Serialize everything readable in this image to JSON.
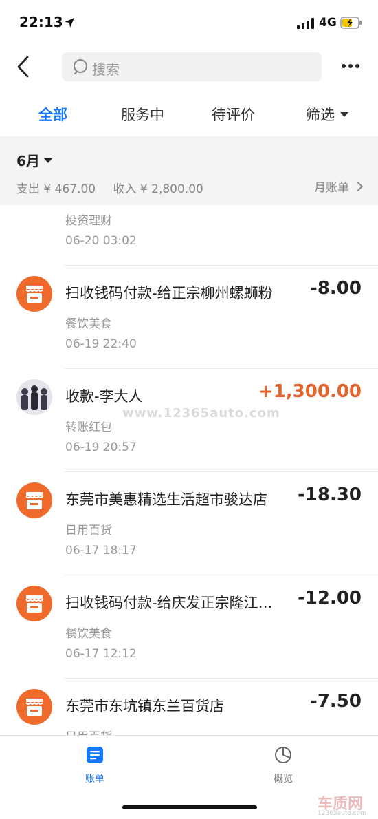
{
  "status_bar": {
    "time": "22:13",
    "network": "4G"
  },
  "search": {
    "placeholder": "搜索"
  },
  "tabs": [
    {
      "label": "全部",
      "active": true
    },
    {
      "label": "服务中",
      "active": false
    },
    {
      "label": "待评价",
      "active": false
    },
    {
      "label": "筛选",
      "active": false
    }
  ],
  "month": {
    "label": "6月",
    "expense": "支出 ¥ 467.00",
    "income": "收入 ¥ 2,800.00",
    "bill_link": "月账单"
  },
  "transactions": [
    {
      "title": "",
      "category": "投资理财",
      "date": "06-20  03:02",
      "amount": "",
      "type": "partial"
    },
    {
      "title": "扫收钱码付款-给正宗柳州螺蛳粉",
      "category": "餐饮美食",
      "date": "06-19  22:40",
      "amount": "-8.00",
      "type": "expense"
    },
    {
      "title": "收款-李大人",
      "category": "转账红包",
      "date": "06-19  20:57",
      "amount": "+1,300.00",
      "type": "income"
    },
    {
      "title": "东莞市美惠精选生活超市骏达店",
      "category": "日用百货",
      "date": "06-17  18:17",
      "amount": "-18.30",
      "type": "expense"
    },
    {
      "title": "扫收钱码付款-给庆发正宗隆江…",
      "category": "餐饮美食",
      "date": "06-17  12:12",
      "amount": "-12.00",
      "type": "expense"
    },
    {
      "title": "东莞市东坑镇东兰百货店",
      "category": "日用百货",
      "date": "",
      "amount": "-7.50",
      "type": "expense"
    }
  ],
  "tabbar": {
    "bill": "账单",
    "overview": "概览"
  },
  "watermarks": {
    "center": "www.12365auto.com",
    "brand": "车质网",
    "brand_url": "12365auto.com"
  },
  "colors": {
    "accent": "#1677ff",
    "income": "#e4632a",
    "store_icon": "#f06b2b"
  }
}
